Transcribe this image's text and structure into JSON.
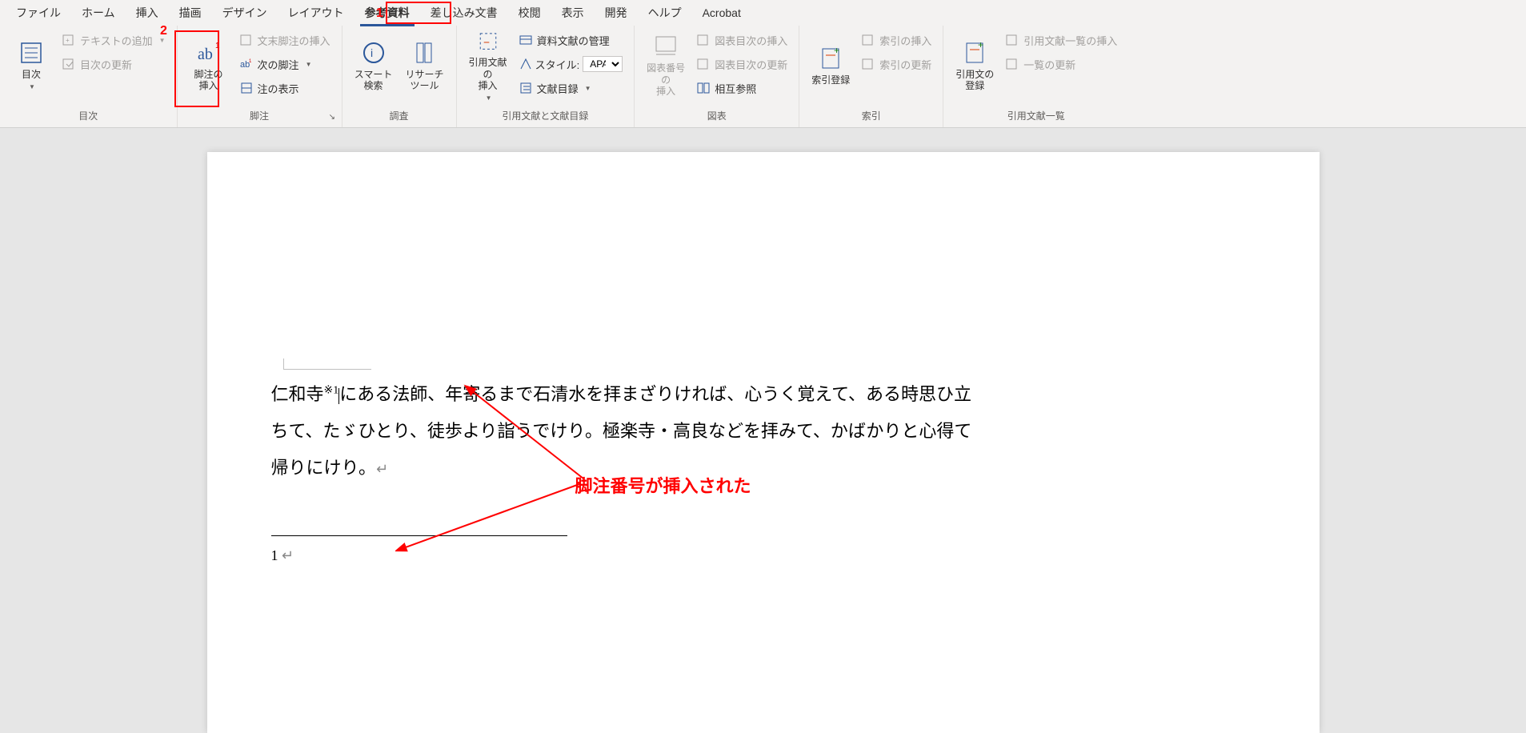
{
  "tabs": {
    "file": "ファイル",
    "home": "ホーム",
    "insert": "挿入",
    "draw": "描画",
    "design": "デザイン",
    "layout": "レイアウト",
    "references": "参考資料",
    "mailings": "差し込み文書",
    "review": "校閲",
    "view": "表示",
    "developer": "開発",
    "help": "ヘルプ",
    "acrobat": "Acrobat"
  },
  "annotations": {
    "marker1": "1",
    "marker2": "2",
    "callout": "脚注番号が挿入された"
  },
  "ribbon": {
    "toc": {
      "label": "目次",
      "btn": "目次",
      "add_text": "テキストの追加",
      "update": "目次の更新"
    },
    "footnotes": {
      "label": "脚注",
      "insert": "脚注の\n挿入",
      "insert_endnote": "文末脚注の挿入",
      "next": "次の脚注",
      "show": "注の表示"
    },
    "research": {
      "label": "調査",
      "smart": "スマート\n検索",
      "researcher": "リサーチ\nツール"
    },
    "citations": {
      "label": "引用文献と文献目録",
      "insert_citation": "引用文献の\n挿入",
      "manage": "資料文献の管理",
      "style": "スタイル:",
      "style_value": "APA",
      "bibliography": "文献目録"
    },
    "captions": {
      "label": "図表",
      "insert_caption": "図表番号の\n挿入",
      "insert_tof": "図表目次の挿入",
      "update_tof": "図表目次の更新",
      "cross_ref": "相互参照"
    },
    "index": {
      "label": "索引",
      "mark_entry": "索引登録",
      "insert_index": "索引の挿入",
      "update_index": "索引の更新"
    },
    "authorities": {
      "label": "引用文献一覧",
      "mark_citation": "引用文の\n登録",
      "insert_toa": "引用文献一覧の挿入",
      "update_toa": "一覧の更新"
    }
  },
  "document": {
    "line1_pre": "仁和寺",
    "footnote_ref": "※1",
    "line1_post": "にある法師、年寄るまで石清水を拝まざりければ、心うく覚えて、ある時思ひ立",
    "line2": "ちて、たゞひとり、徒歩より詣うでけり。極楽寺・高良などを拝みて、かばかりと心得て",
    "line3": "帰りにけり。",
    "footnote_num": "1"
  }
}
